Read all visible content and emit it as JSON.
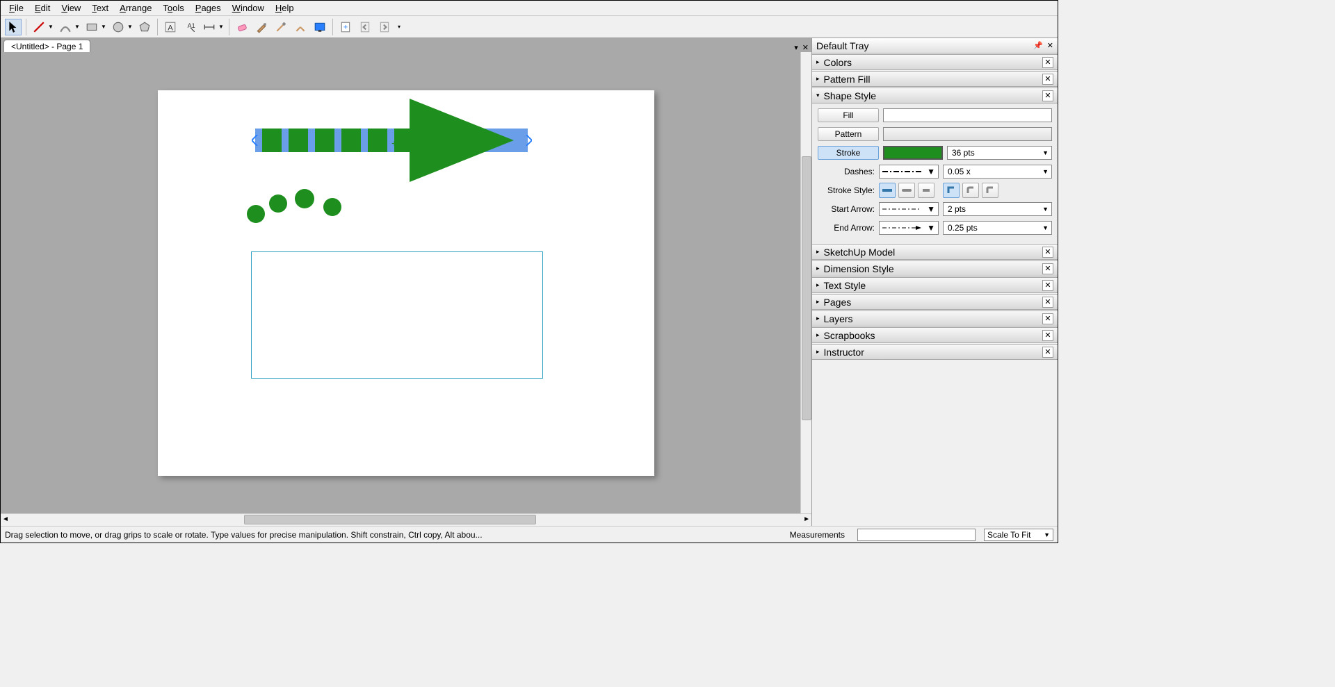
{
  "menubar": [
    "File",
    "Edit",
    "View",
    "Text",
    "Arrange",
    "Tools",
    "Pages",
    "Window",
    "Help"
  ],
  "tab_title": "<Untitled> - Page 1",
  "tray_title": "Default Tray",
  "panels": {
    "colors": "Colors",
    "pattern_fill": "Pattern Fill",
    "shape_style": "Shape Style",
    "sketchup": "SketchUp Model",
    "dimension": "Dimension Style",
    "text_style": "Text Style",
    "pages": "Pages",
    "layers": "Layers",
    "scrapbooks": "Scrapbooks",
    "instructor": "Instructor"
  },
  "shape_style": {
    "fill_label": "Fill",
    "pattern_label": "Pattern",
    "stroke_label": "Stroke",
    "stroke_size": "36 pts",
    "dashes_label": "Dashes:",
    "dashes_value": "0.05 x",
    "stroke_style_label": "Stroke Style:",
    "start_arrow_label": "Start Arrow:",
    "start_arrow_value": "2 pts",
    "end_arrow_label": "End Arrow:",
    "end_arrow_value": "0.25 pts"
  },
  "statusbar": {
    "hint": "Drag selection to move, or drag grips to scale or rotate. Type values for precise manipulation. Shift constrain, Ctrl copy, Alt abou...",
    "measurements_label": "Measurements",
    "zoom": "Scale To Fit"
  }
}
